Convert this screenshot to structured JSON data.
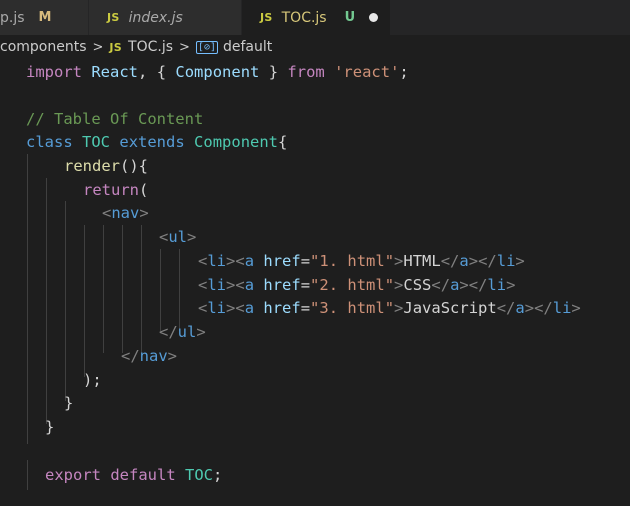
{
  "tabs": [
    {
      "name": "p.js",
      "status": "M"
    },
    {
      "icon": "JS",
      "name": "index.js"
    },
    {
      "icon": "JS",
      "name": "TOC.js",
      "status": "U"
    }
  ],
  "breadcrumb": {
    "folder": "components",
    "js_icon": "JS",
    "file": "TOC.js",
    "symbol_icon": "[⊘]",
    "symbol": "default"
  },
  "code": {
    "l1": {
      "kw": "import",
      "name": "React",
      "brace_open": "{",
      "comp": "Component",
      "brace_close": "}",
      "from": "from",
      "str": "'react'",
      "end": ";"
    },
    "l3": {
      "comment": "// Table Of Content"
    },
    "l4": {
      "kw": "class",
      "name": "TOC",
      "ext": "extends",
      "base": "Component",
      "brace": "{"
    },
    "l5": {
      "fn": "render",
      "rest": "(){"
    },
    "l6": {
      "kw": "return",
      "rest": "("
    },
    "l7": {
      "tag": "nav"
    },
    "l8": {
      "tag": "ul"
    },
    "li": [
      {
        "li": "li",
        "a": "a",
        "attr": "href",
        "eq": "=",
        "href": "\"1. html\"",
        "text": "HTML"
      },
      {
        "li": "li",
        "a": "a",
        "attr": "href",
        "eq": "=",
        "href": "\"2. html\"",
        "text": "CSS"
      },
      {
        "li": "li",
        "a": "a",
        "attr": "href",
        "eq": "=",
        "href": "\"3. html\"",
        "text": "JavaScript"
      }
    ],
    "l12": {
      "tag": "ul"
    },
    "l13": {
      "tag": "nav"
    },
    "l14": {
      "text": ");"
    },
    "l15": {
      "text": "}"
    },
    "l16": {
      "text": "}"
    },
    "l18": {
      "kw": "export",
      "kw2": "default",
      "name": "TOC",
      "end": ";"
    }
  }
}
